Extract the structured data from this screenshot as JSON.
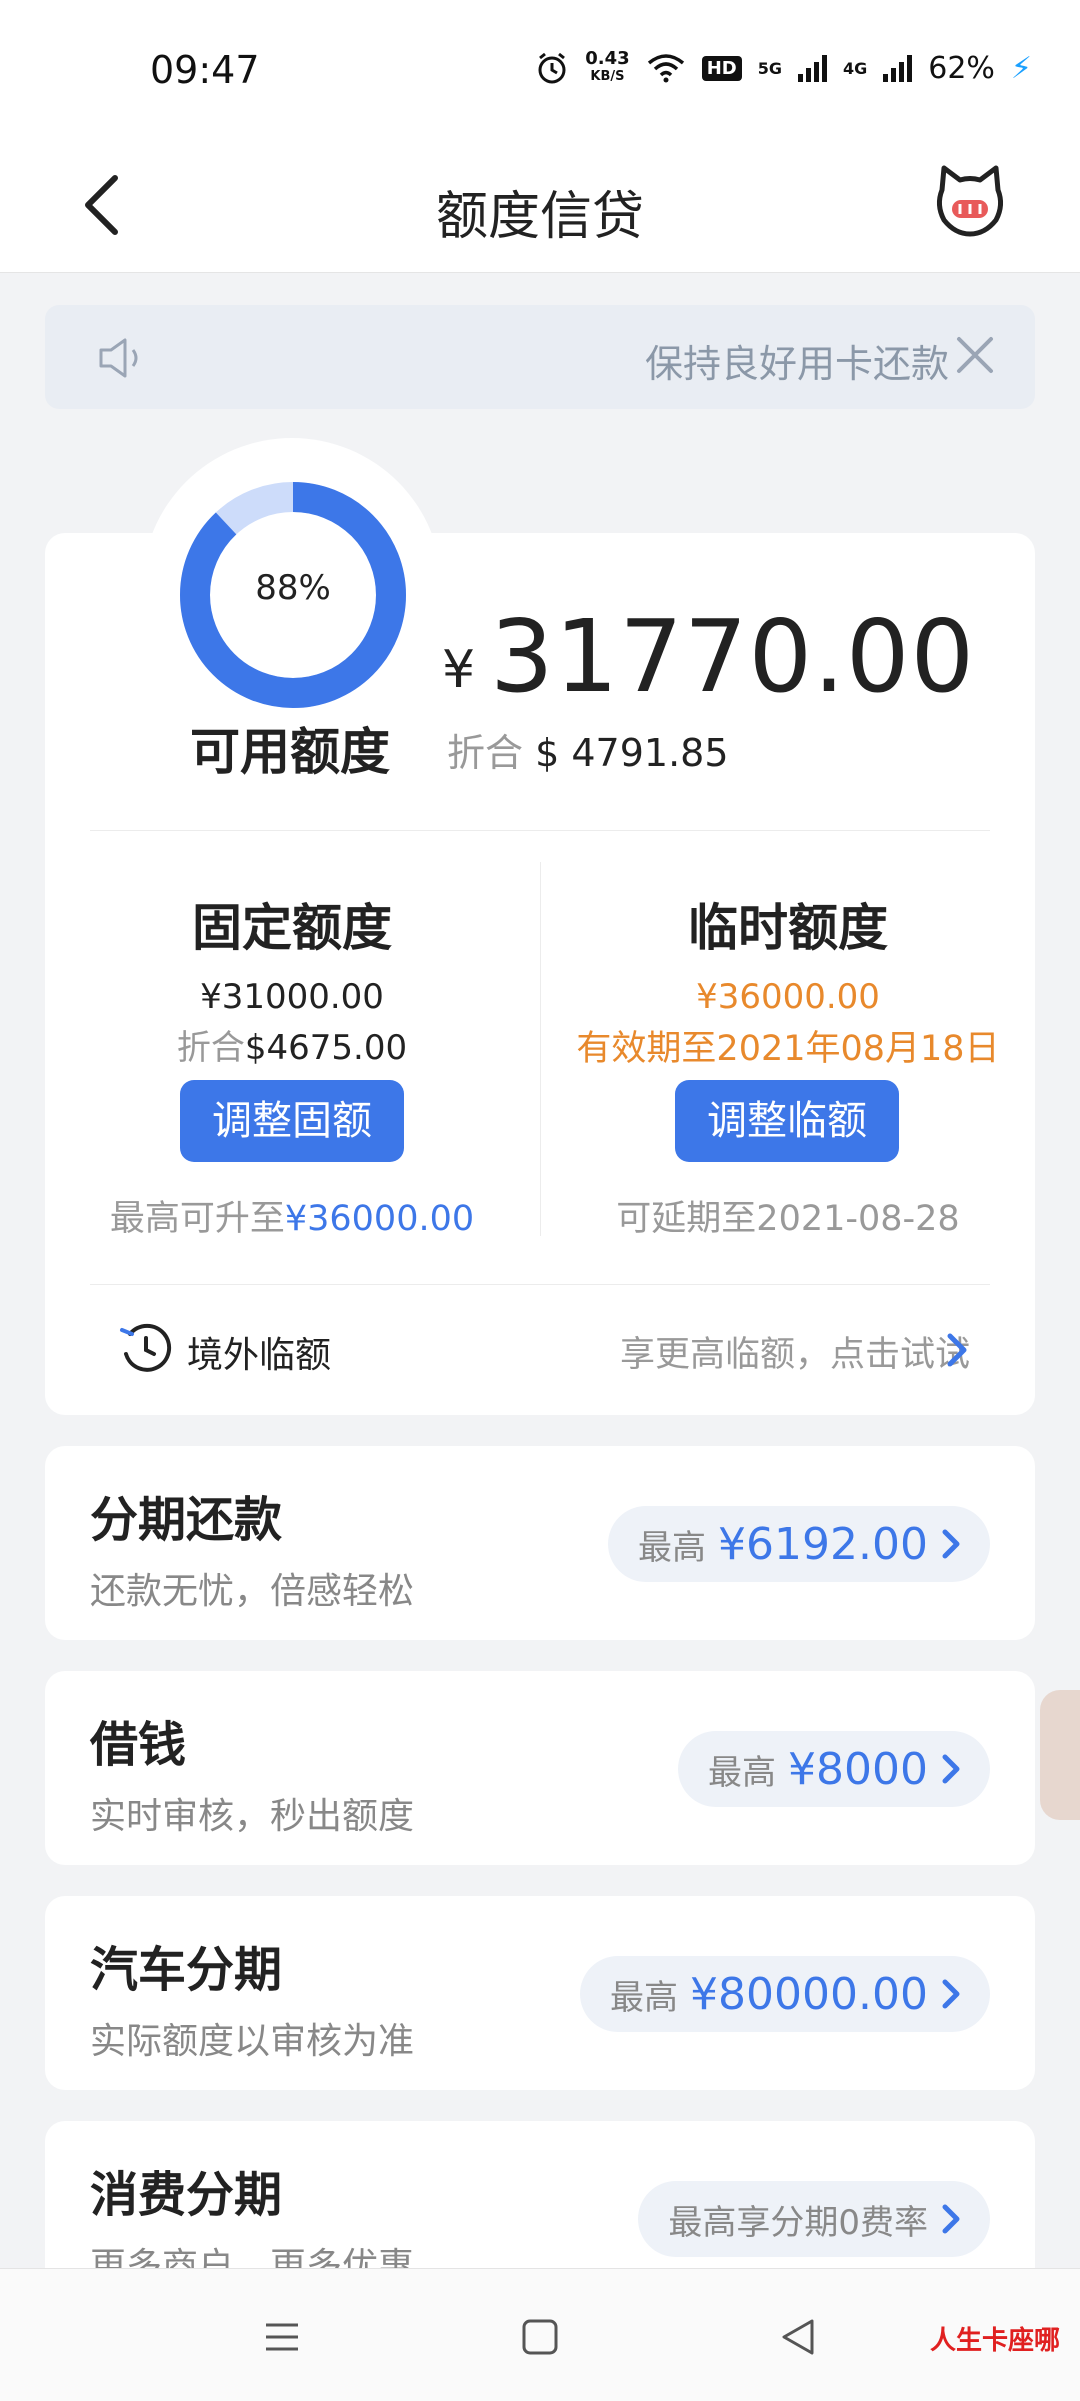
{
  "status_bar": {
    "time": "09:47",
    "net_speed_value": "0.43",
    "net_speed_unit": "KB/S",
    "hd_badge": "HD",
    "net_5g": "5G",
    "net_4g": "4G",
    "battery": "62%",
    "icons": [
      "alarm-icon",
      "wifi-icon",
      "signal-icon",
      "charging-icon"
    ]
  },
  "header": {
    "title": "额度信贷",
    "back_icon": "chevron-left-icon",
    "right_icon": "cat-mascot-icon"
  },
  "notice": {
    "text": "保持良好用卡还款",
    "icon": "speaker-icon",
    "close_icon": "close-icon"
  },
  "credit": {
    "ring_percent": 0.88,
    "ring_label": "88%",
    "available_label": "可用额度",
    "currency_symbol": "¥",
    "available_amount": "31770.00",
    "usd_prefix": "折合",
    "usd_amount": "$ 4791.85",
    "accent_color": "#3d77e8",
    "ring_track_color": "#cddcfa",
    "fixed": {
      "title": "固定额度",
      "amount": "¥31000.00",
      "usd_prefix": "折合",
      "usd_amount": "$4675.00",
      "button": "调整固额",
      "max_prefix": "最高可升至",
      "max_value": "¥36000.00"
    },
    "temporary": {
      "title": "临时额度",
      "amount": "¥36000.00",
      "validity": "有效期至2021年08月18日",
      "button": "调整临额",
      "extend": "可延期至2021-08-28"
    },
    "overseas": {
      "label": "境外临额",
      "hint": "享更高临额，点击试试"
    }
  },
  "loan_products": [
    {
      "title": "分期还款",
      "subtitle": "还款无忧，倍感轻松",
      "prefix": "最高",
      "value": "¥6192.00"
    },
    {
      "title": "借钱",
      "subtitle": "实时审核，秒出额度",
      "prefix": "最高",
      "value": "¥8000"
    },
    {
      "title": "汽车分期",
      "subtitle": "实际额度以审核为准",
      "prefix": "最高",
      "value": "¥80000.00"
    },
    {
      "title": "消费分期",
      "subtitle": "更多商户，更多优惠",
      "prefix": "最高享分期0费率",
      "value": ""
    }
  ],
  "watermark": "人生卡座哪",
  "system_nav": [
    "menu-icon",
    "home-square-icon",
    "back-triangle-icon"
  ]
}
